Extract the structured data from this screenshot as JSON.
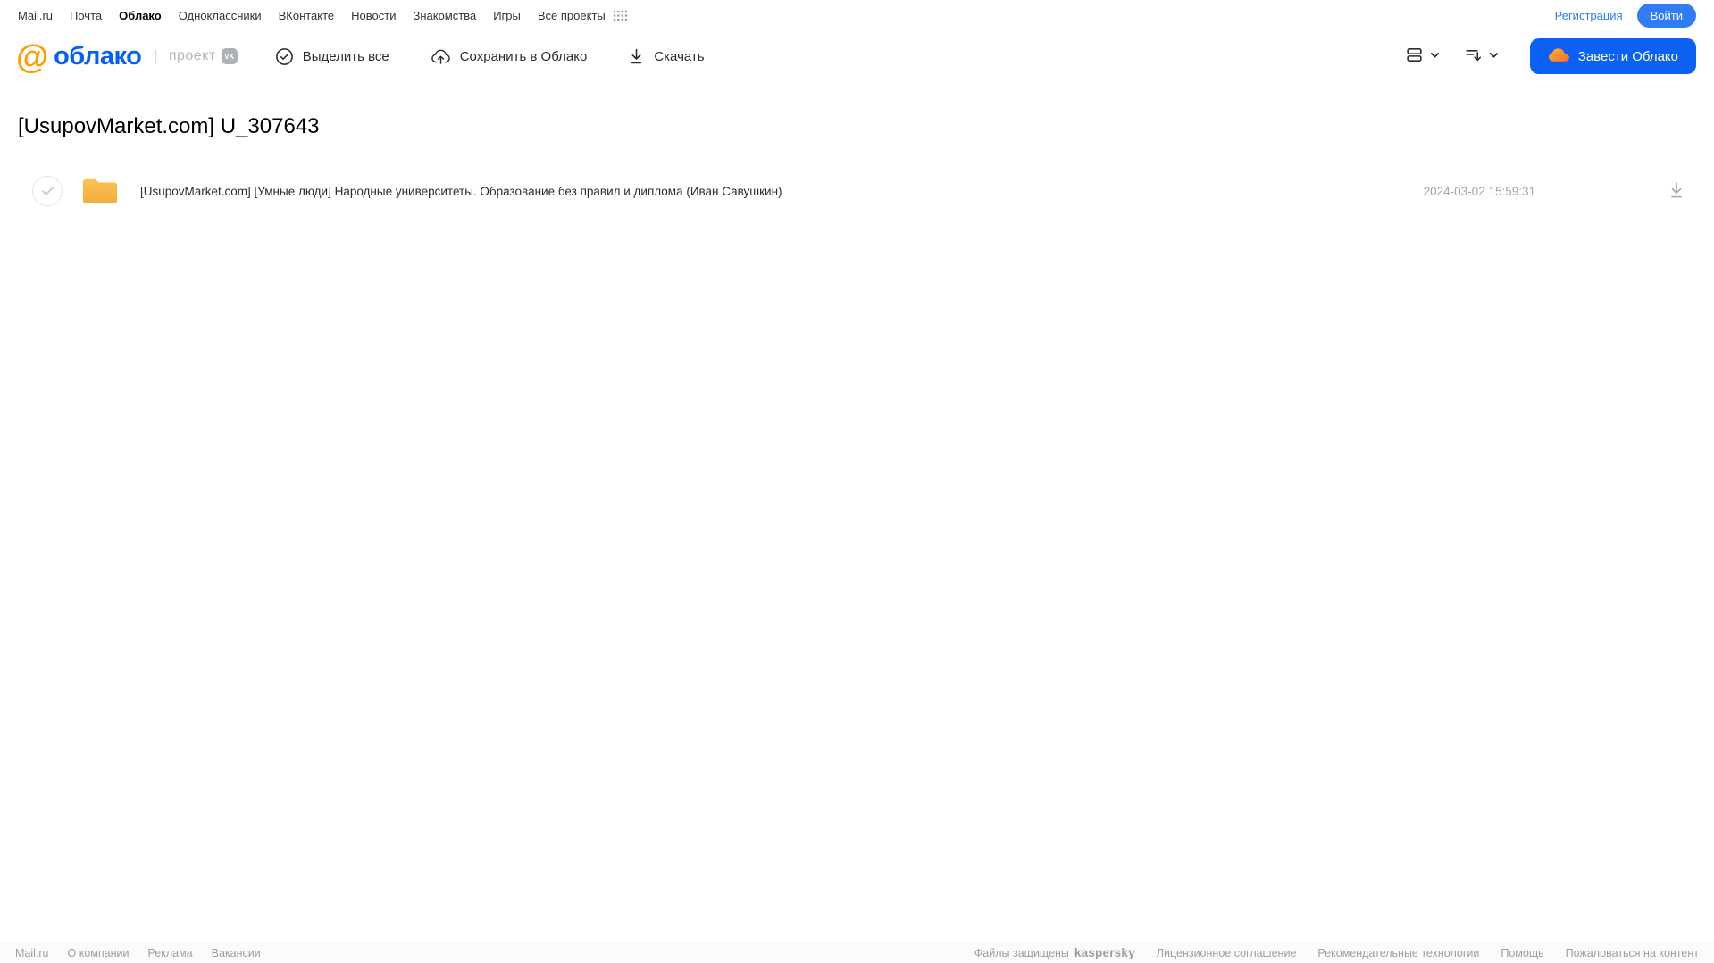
{
  "topnav": {
    "items": [
      {
        "label": "Mail.ru"
      },
      {
        "label": "Почта"
      },
      {
        "label": "Облако"
      },
      {
        "label": "Одноклассники"
      },
      {
        "label": "ВКонтакте"
      },
      {
        "label": "Новости"
      },
      {
        "label": "Знакомства"
      },
      {
        "label": "Игры"
      },
      {
        "label": "Все проекты"
      }
    ],
    "registration_label": "Регистрация",
    "login_label": "Войти"
  },
  "header": {
    "logo_at": "@",
    "logo_text": "облако",
    "project_separator": "|",
    "project_label": "проект",
    "project_badge": "vk",
    "toolbar": {
      "select_all_label": "Выделить все",
      "save_to_cloud_label": "Сохранить в Облако",
      "download_label": "Скачать"
    },
    "get_cloud_label": "Завести Облако"
  },
  "main": {
    "title": "[UsupovMarket.com] U_307643",
    "files": [
      {
        "type": "folder",
        "name": "[UsupovMarket.com] [Умные люди] Народные университеты. Образование без правил и диплома (Иван Савушкин)",
        "date": "2024-03-02 15:59:31"
      }
    ]
  },
  "footer": {
    "left_links": [
      "Mail.ru",
      "О компании",
      "Реклама",
      "Вакансии"
    ],
    "protected_text": "Файлы защищены",
    "kaspersky_label": "kaspersky",
    "right_links": [
      "Лицензионное соглашение",
      "Рекомендательные технологии",
      "Помощь",
      "Пожаловаться на контент"
    ]
  },
  "colors": {
    "accent_blue": "#0b61f4",
    "link_blue": "#2f7cf6",
    "logo_orange": "#ff9e00",
    "logo_blue": "#0460f6",
    "folder_yellow": "#f8bc48",
    "kaspersky_green": "#00a88e"
  }
}
